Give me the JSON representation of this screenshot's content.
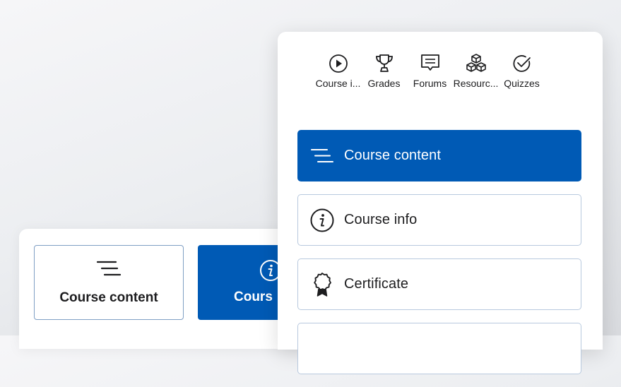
{
  "colors": {
    "accent": "#005ab5",
    "border": "#b8c9de",
    "text": "#1d1d1f",
    "panel": "#ffffff"
  },
  "tile_layout": {
    "tiles": [
      {
        "label": "Course content",
        "icon": "lines-icon",
        "active": false
      },
      {
        "label": "Cours",
        "icon": "info-icon",
        "active": true
      }
    ]
  },
  "nav_drawer": {
    "tabs": [
      {
        "label": "Course i...",
        "icon": "play-circle-icon"
      },
      {
        "label": "Grades",
        "icon": "trophy-icon"
      },
      {
        "label": "Forums",
        "icon": "chat-bubble-icon"
      },
      {
        "label": "Resourc...",
        "icon": "cubes-icon"
      },
      {
        "label": "Quizzes",
        "icon": "check-circle-icon"
      }
    ],
    "menu": [
      {
        "label": "Course content",
        "icon": "lines-icon",
        "active": true
      },
      {
        "label": "Course info",
        "icon": "info-icon",
        "active": false
      },
      {
        "label": "Certificate",
        "icon": "award-icon",
        "active": false
      },
      {
        "label": "",
        "icon": "",
        "active": false
      }
    ]
  }
}
